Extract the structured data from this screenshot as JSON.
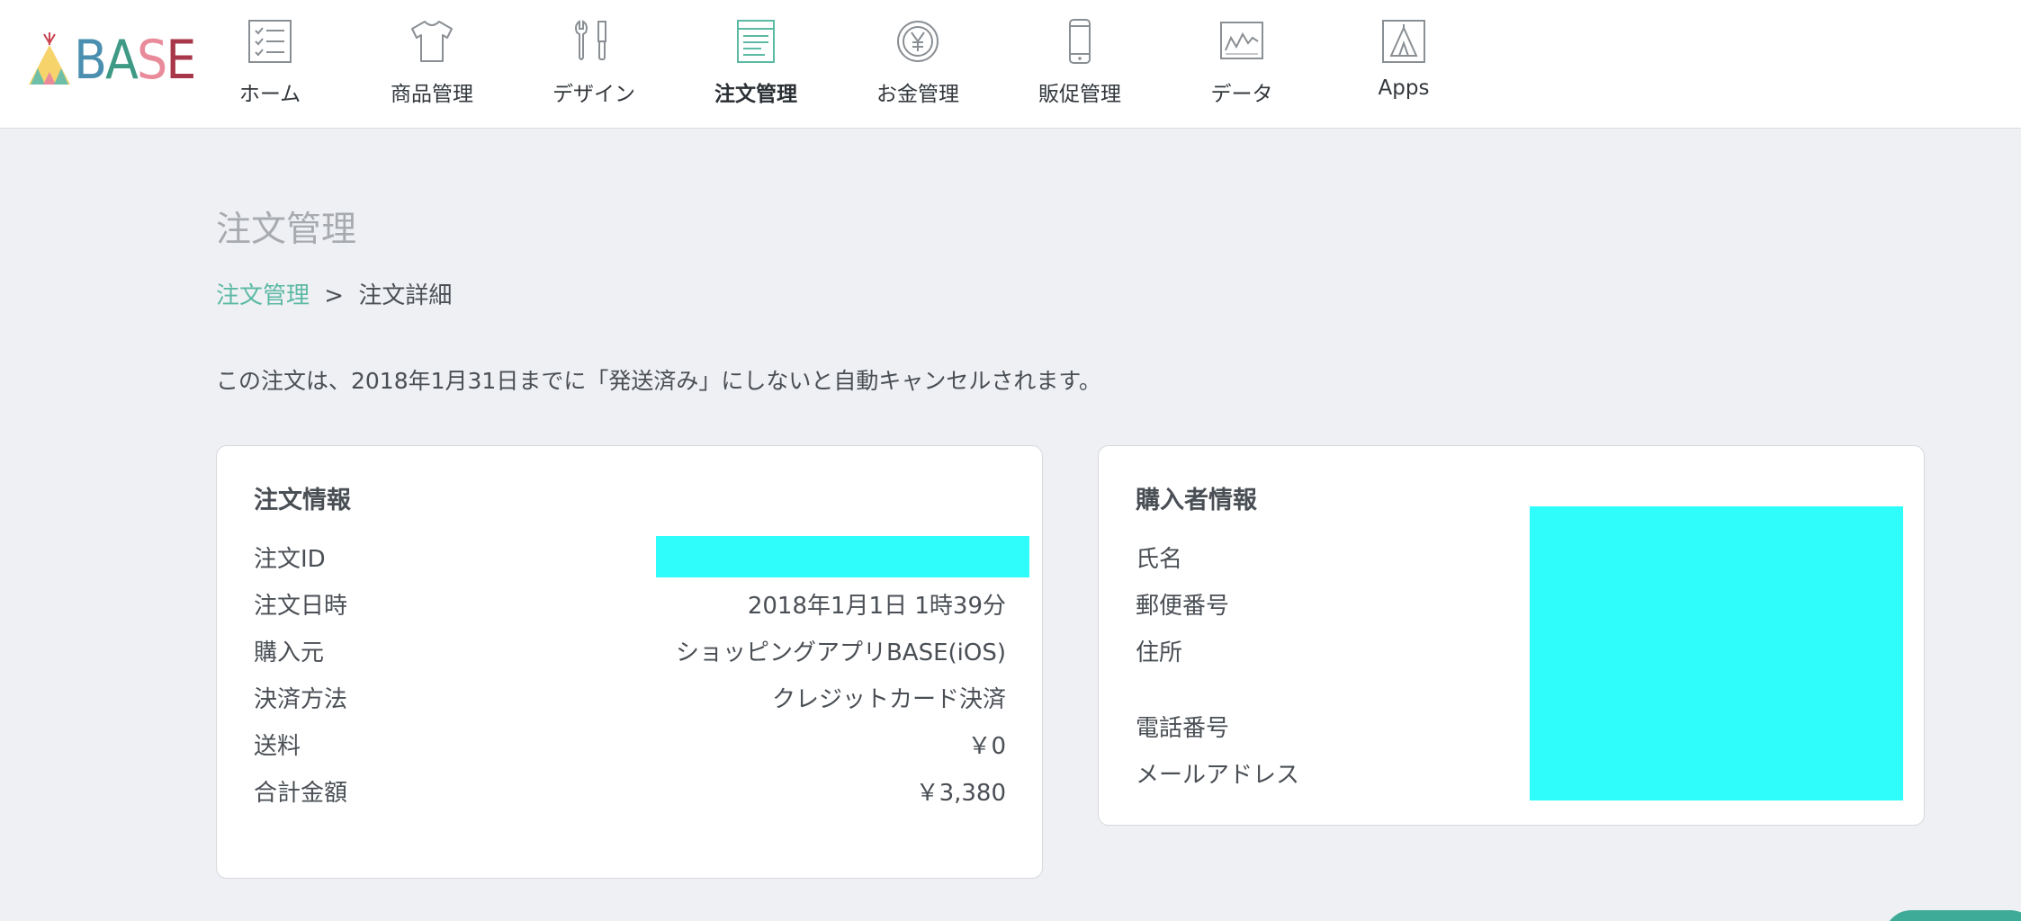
{
  "header": {
    "logo_text": "BASE",
    "nav": [
      {
        "label": "ホーム",
        "icon": "checklist-icon"
      },
      {
        "label": "商品管理",
        "icon": "tshirt-icon"
      },
      {
        "label": "デザイン",
        "icon": "tools-icon"
      },
      {
        "label": "注文管理",
        "icon": "order-document-icon",
        "active": true
      },
      {
        "label": "お金管理",
        "icon": "yen-coin-icon"
      },
      {
        "label": "販促管理",
        "icon": "smartphone-icon"
      },
      {
        "label": "データ",
        "icon": "chart-icon"
      },
      {
        "label": "Apps",
        "icon": "apps-tent-icon"
      }
    ]
  },
  "colors": {
    "accent": "#5bb9a4",
    "background": "#eff0f3",
    "redaction": "#2efdfb"
  },
  "main": {
    "page_title": "注文管理",
    "breadcrumb": {
      "link": "注文管理",
      "separator": ">",
      "current": "注文詳細"
    },
    "notice": "この注文は、2018年1月31日までに「発送済み」にしないと自動キャンセルされます。"
  },
  "order_info": {
    "title": "注文情報",
    "rows": [
      {
        "label": "注文ID",
        "value": ""
      },
      {
        "label": "注文日時",
        "value": "2018年1月1日 1時39分"
      },
      {
        "label": "購入元",
        "value": "ショッピングアプリBASE(iOS)"
      },
      {
        "label": "決済方法",
        "value": "クレジットカード決済"
      },
      {
        "label": "送料",
        "value": "￥0"
      },
      {
        "label": "合計金額",
        "value": "￥3,380"
      }
    ]
  },
  "buyer_info": {
    "title": "購入者情報",
    "rows": [
      {
        "label": "氏名"
      },
      {
        "label": "郵便番号"
      },
      {
        "label": "住所"
      },
      {
        "label": "電話番号"
      },
      {
        "label": "メールアドレス"
      }
    ]
  }
}
